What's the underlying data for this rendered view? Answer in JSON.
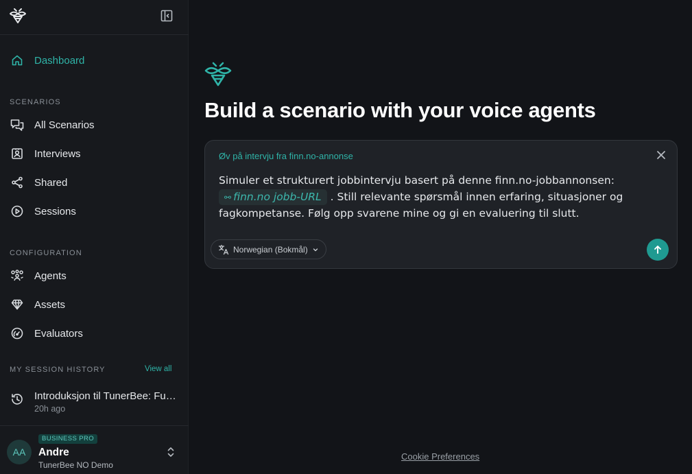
{
  "sidebar": {
    "logo_icon": "bee-logo-icon",
    "collapse_icon": "sidebar-collapse-icon",
    "nav": {
      "dashboard": "Dashboard"
    },
    "sections": {
      "scenarios": "SCENARIOS",
      "configuration": "CONFIGURATION",
      "history": "MY SESSION HISTORY"
    },
    "scenario_items": {
      "all": "All Scenarios",
      "interviews": "Interviews",
      "shared": "Shared",
      "sessions": "Sessions"
    },
    "config_items": {
      "agents": "Agents",
      "assets": "Assets",
      "evaluators": "Evaluators"
    },
    "view_all": "View all",
    "history": {
      "title": "Introduksjon til TunerBee: Funksjoner og bruk",
      "time": "20h ago"
    },
    "user": {
      "initials": "AA",
      "plan": "BUSINESS PRO",
      "name": "Andre",
      "org": "TunerBee NO Demo"
    }
  },
  "main": {
    "headline": "Build a scenario with your voice agents",
    "composer": {
      "label": "Øv på intervju fra finn.no-annonse",
      "prompt_before": "Simuler et strukturert jobbintervju basert på denne finn.no-jobbannonsen: ",
      "chip": "finn.no jobb-URL",
      "prompt_after": " . Still relevante spørsmål innen erfaring, situasjoner og fagkompetanse. Følg opp svarene mine og gi en evaluering til slutt.",
      "language": "Norwegian (Bokmål)"
    },
    "cookie": "Cookie Preferences"
  },
  "colors": {
    "accent": "#2fb4a8",
    "background": "#121418",
    "sidebar": "#17191d",
    "composer": "#1f2227",
    "send": "#1f9a91"
  }
}
